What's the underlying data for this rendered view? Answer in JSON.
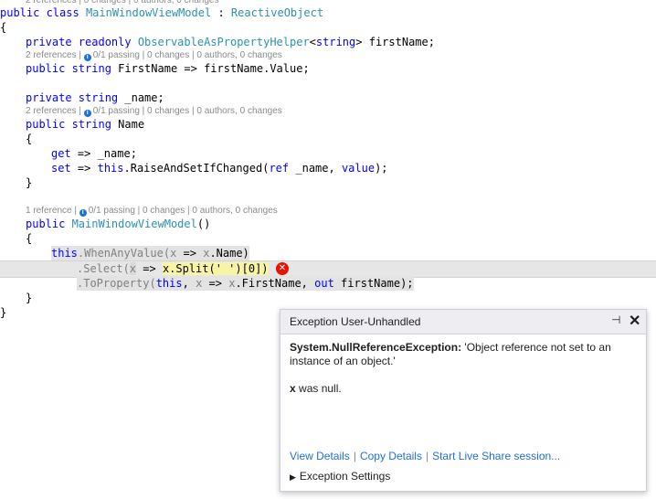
{
  "lens": {
    "top_partial": "2 references | 0 changes | 0 authors, 0 changes",
    "first_name": "2 references | 0/1 passing | 0 changes | 0 authors, 0 changes",
    "name_field": "2 references | 0/1 passing | 0 changes | 0 authors, 0 changes",
    "ctor": "1 reference | 0/1 passing | 0 changes | 0 authors, 0 changes"
  },
  "code": {
    "l1": {
      "a": "public ",
      "b": "class ",
      "c": "MainWindowViewModel",
      "d": " : ",
      "e": "ReactiveObject"
    },
    "l2": "{",
    "l3": {
      "a": "private ",
      "b": "readonly ",
      "c": "ObservableAsPropertyHelper",
      "d": "<",
      "e": "string",
      "f": "> firstName;"
    },
    "l4": {
      "a": "public ",
      "b": "string ",
      "c": "FirstName => firstName.Value;"
    },
    "l5": {
      "a": "private ",
      "b": "string ",
      "c": "_name;"
    },
    "l6": {
      "a": "public ",
      "b": "string ",
      "c": "Name"
    },
    "l7": "{",
    "l8": {
      "a": "get",
      "b": " => _name;"
    },
    "l9": {
      "a": "set",
      "b": " => ",
      "c": "this",
      "d": ".RaiseAndSetIfChanged(",
      "e": "ref",
      "f": " _name, ",
      "g": "value",
      "h": ");"
    },
    "l10": "}",
    "l11": {
      "a": "public ",
      "b": "MainWindowViewModel",
      "c": "()"
    },
    "l12": "{",
    "l13": {
      "a": "this",
      "b": ".WhenAnyValue(",
      "c": "x",
      "d": " => ",
      "e": "x",
      "f": ".Name)"
    },
    "l14": {
      "a": ".Select(",
      "b": "x",
      "c": " => ",
      "d": "x.Split(' ')[0])"
    },
    "l15": {
      "a": ".ToProperty(",
      "b": "this",
      "c": ", ",
      "d": "x",
      "e": " => ",
      "f": "x",
      "g": ".FirstName, ",
      "h": "out",
      "i": " firstName);"
    },
    "l16": "}",
    "l17": "}"
  },
  "popup": {
    "title": "Exception User-Unhandled",
    "pin_glyph": "⊣",
    "close_glyph": "✕",
    "exception_type": "System.NullReferenceException:",
    "exception_msg": " 'Object reference not set to an",
    "exception_msg2": "instance of an object.'",
    "null_var": "x",
    "null_msg": " was null.",
    "links": [
      "View Details",
      "Copy Details",
      "Start Live Share session..."
    ],
    "settings_label": "Exception Settings"
  },
  "colors": {
    "keyword": "#0000ff",
    "type": "#2b91af",
    "error": "#e51400",
    "link": "#1e6fd9"
  }
}
